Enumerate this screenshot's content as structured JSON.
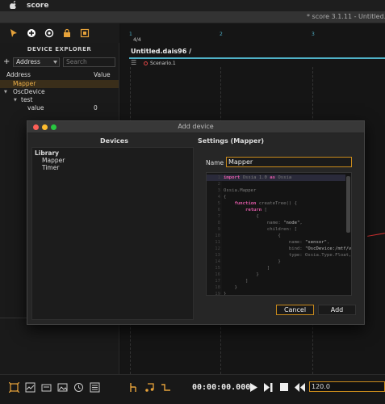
{
  "menubar": {
    "apple": "",
    "app": "score"
  },
  "window": {
    "title": "* score 3.1.11 - Untitled.dais"
  },
  "explorer": {
    "header": "DEVICE EXPLORER",
    "filter_plus": "+",
    "address_option": "Address",
    "search_placeholder": "Search",
    "col_address": "Address",
    "col_value": "Value",
    "rows": [
      {
        "label": "Mapper",
        "value": ""
      },
      {
        "label": "OscDevice",
        "value": ""
      },
      {
        "label": "test",
        "value": ""
      },
      {
        "label": "value",
        "value": "0"
      }
    ]
  },
  "canvas": {
    "ruler": [
      "1",
      "2",
      "3"
    ],
    "signature": "4/4",
    "doc_title": "Untitled.dais96 /",
    "scenario": "Scenario.1"
  },
  "transport": {
    "timecode": "00:00:00.000",
    "tempo": "120.0"
  },
  "dialog": {
    "title": "Add device",
    "devices_header": "Devices",
    "settings_header": "Settings (Mapper)",
    "library_label": "Library",
    "library_items": [
      "Mapper",
      "Timer"
    ],
    "name_label": "Name",
    "name_value": "Mapper",
    "code_lines": [
      "import Ossia 1.0 as Ossia",
      "",
      "Ossia.Mapper",
      "{",
      "    function createTree() {",
      "        return [",
      "            {",
      "                name: \"node\",",
      "                children: [",
      "                    {",
      "                        name: \"sensor\",",
      "                        bind: \"OscDevice:/mtf/value\",",
      "                        type: Ossia.Type.Float,",
      "                    }",
      "                ]",
      "            }",
      "        ]",
      "    }",
      "}"
    ],
    "cancel_label": "Cancel",
    "add_label": "Add"
  },
  "colors": {
    "accent": "#c88a1c",
    "timeline": "#4fb0c6",
    "selected_row": "#f0b34a"
  }
}
